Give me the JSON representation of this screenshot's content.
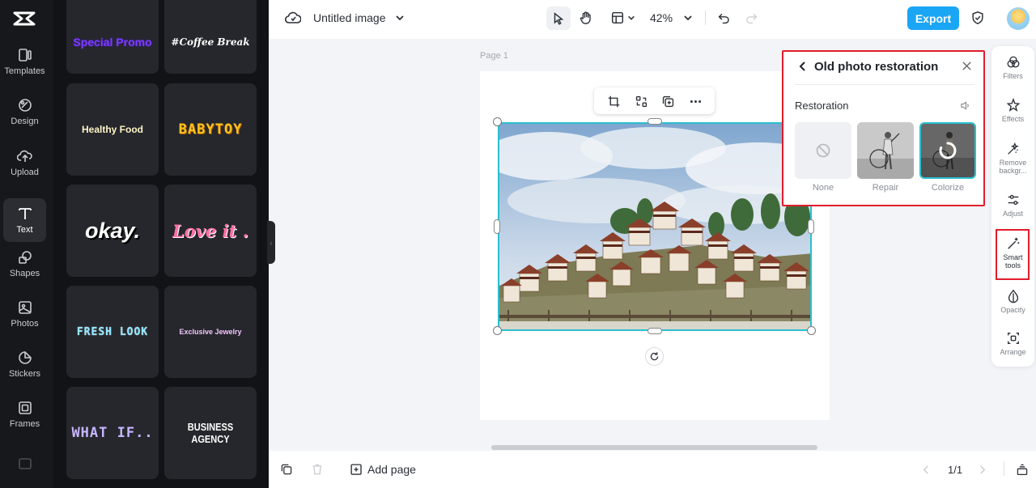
{
  "sidebar": {
    "items": [
      {
        "label": "Templates",
        "icon": "templates-icon"
      },
      {
        "label": "Design",
        "icon": "design-icon"
      },
      {
        "label": "Upload",
        "icon": "upload-icon"
      },
      {
        "label": "Text",
        "icon": "text-icon",
        "active": true
      },
      {
        "label": "Shapes",
        "icon": "shapes-icon"
      },
      {
        "label": "Photos",
        "icon": "photos-icon"
      },
      {
        "label": "Stickers",
        "icon": "stickers-icon"
      },
      {
        "label": "Frames",
        "icon": "frames-icon"
      }
    ]
  },
  "text_styles": [
    {
      "label": "Special Promo",
      "color": "#7b3cff"
    },
    {
      "label": "#Coffee Break",
      "color": "#ffffff"
    },
    {
      "label": "Healthy Food",
      "color": "#fff6c8"
    },
    {
      "label": "BABYTOY",
      "color": "#ffc21a"
    },
    {
      "label": "okay.",
      "color": "#ffffff"
    },
    {
      "label": "Love it .",
      "color": "#ff6fa5"
    },
    {
      "label": "FRESH LOOK",
      "color": "#8fe6ff"
    },
    {
      "label": "Exclusive Jewelry",
      "color": "#f3c6ff"
    },
    {
      "label": "WHAT IF..",
      "color": "#c7b6ff"
    },
    {
      "label": "BUSINESS AGENCY",
      "color": "#ffffff"
    }
  ],
  "header": {
    "doc_title": "Untitled image",
    "zoom": "42%",
    "export_label": "Export"
  },
  "canvas": {
    "page_label": "Page 1"
  },
  "restoration_panel": {
    "title": "Old photo restoration",
    "section": "Restoration",
    "options": [
      {
        "label": "None",
        "selected": false
      },
      {
        "label": "Repair",
        "selected": false
      },
      {
        "label": "Colorize",
        "selected": true
      }
    ]
  },
  "right_tools": [
    {
      "label": "Filters",
      "icon": "filters-icon"
    },
    {
      "label": "Effects",
      "icon": "effects-icon"
    },
    {
      "label": "Remove backgr...",
      "icon": "remove-background-icon"
    },
    {
      "label": "Adjust",
      "icon": "adjust-icon"
    },
    {
      "label": "Smart tools",
      "icon": "smart-tools-icon",
      "highlighted": true
    },
    {
      "label": "Opacity",
      "icon": "opacity-icon"
    },
    {
      "label": "Arrange",
      "icon": "arrange-icon"
    }
  ],
  "footer": {
    "add_page_label": "Add page",
    "page_counter": "1/1"
  },
  "colors": {
    "accent": "#1ba6f5",
    "highlight_border": "#e11d2c",
    "selection": "#2bbfcf"
  }
}
